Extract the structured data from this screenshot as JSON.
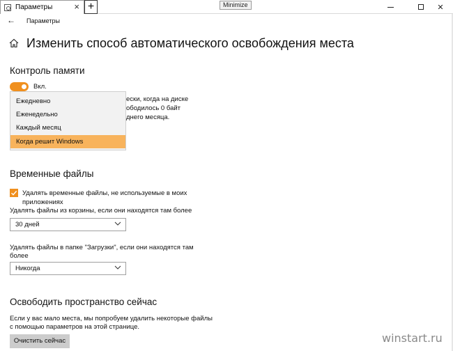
{
  "window": {
    "tab_title": "Параметры",
    "tab_close": "×",
    "new_tab": "+",
    "tooltip": "Minimize",
    "minimize_icon": "minimize-icon",
    "maximize_icon": "maximize-icon",
    "close_glyph": "✕"
  },
  "header": {
    "back_glyph": "←",
    "app_title": "Параметры",
    "page_title": "Изменить способ автоматического освобождения места"
  },
  "storage_sense": {
    "heading": "Контроль памяти",
    "toggle_state": "on",
    "toggle_label": "Вкл.",
    "hidden_text_1": "ески, когда на диске",
    "hidden_text_2": "ободилось 0 байт",
    "hidden_text_3": "днего месяца.",
    "dropdown_options": [
      "Ежедневно",
      "Еженедельно",
      "Каждый месяц",
      "Когда решит Windows"
    ],
    "dropdown_selected": "Когда решит Windows"
  },
  "temp_files": {
    "heading": "Временные файлы",
    "checkbox_checked": true,
    "checkbox_label_1": "Удалять временные файлы, не используемые в моих",
    "checkbox_label_2": "приложениях",
    "recycle_label": "Удалять файлы из корзины, если они находятся там более",
    "recycle_value": "30 дней",
    "downloads_label_1": "Удалять файлы в папке \"Загрузки\", если они находятся там",
    "downloads_label_2": "более",
    "downloads_value": "Никогда"
  },
  "free_now": {
    "heading": "Освободить пространство сейчас",
    "desc_1": "Если у вас мало места, мы попробуем удалить некоторые файлы",
    "desc_2": "с помощью параметров на этой странице.",
    "button_label": "Очистить сейчас"
  },
  "watermark": "winstart.ru",
  "colors": {
    "accent": "#f0901f",
    "selected_item": "#f8b35c",
    "popup_bg": "#f2f2f2",
    "button_bg": "#cccccc"
  }
}
